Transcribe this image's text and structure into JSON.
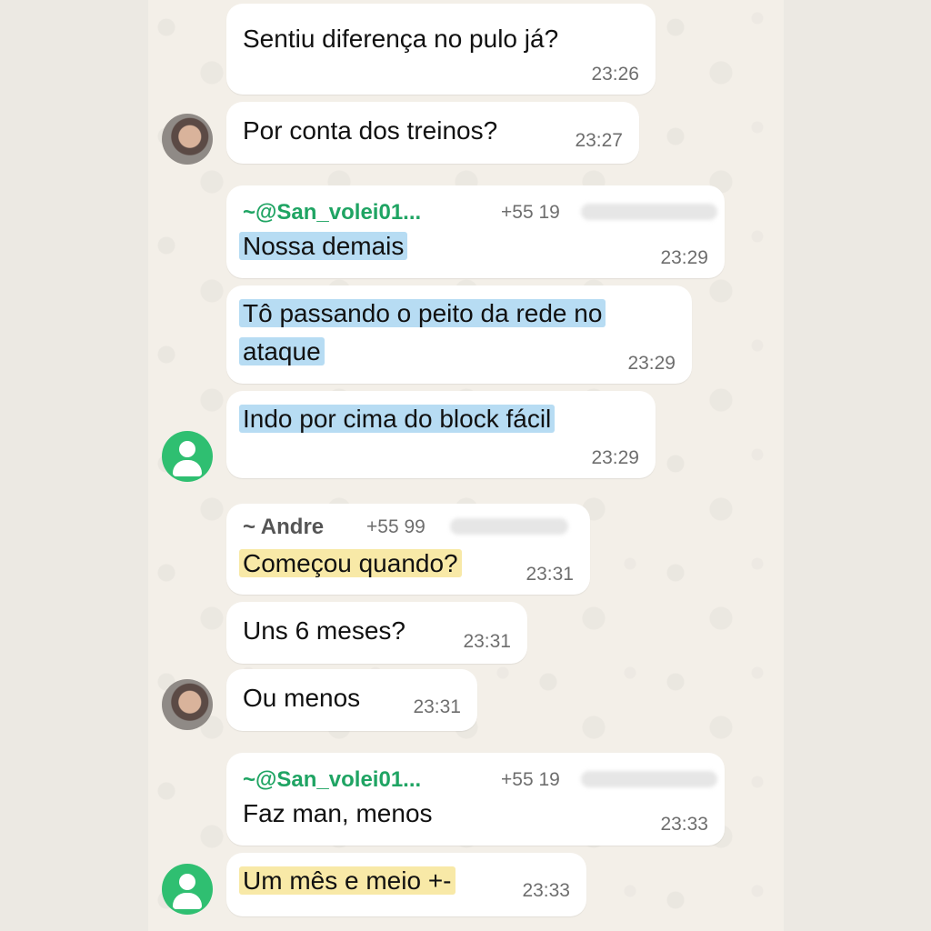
{
  "messages": [
    {
      "text": "Sentiu diferença no pulo já?",
      "time": "23:26"
    },
    {
      "text": "Por conta dos treinos?",
      "time": "23:27"
    },
    {
      "sender": "~@San_volei01...",
      "phone": "+55 19",
      "text": "Nossa demais",
      "time": "23:29"
    },
    {
      "line1": "Tô passando o peito da rede no",
      "line2": "ataque",
      "time": "23:29"
    },
    {
      "text": "Indo por cima do block fácil",
      "time": "23:29"
    },
    {
      "sender": "~ Andre",
      "phone": "+55 99",
      "text": "Começou quando?",
      "time": "23:31"
    },
    {
      "text": "Uns 6 meses?",
      "time": "23:31"
    },
    {
      "text": "Ou menos",
      "time": "23:31"
    },
    {
      "sender": "~@San_volei01...",
      "phone": "+55 19",
      "text": "Faz man, menos",
      "time": "23:33"
    },
    {
      "text": "Um mês e meio +-",
      "time": "23:33"
    }
  ],
  "colors": {
    "sender_green": "#1fa463",
    "highlight_blue": "#b7dcf3",
    "highlight_yellow": "#f8e9a7",
    "avatar_green": "#2fbf71"
  },
  "icons": {
    "default_avatar": "person-silhouette-icon"
  }
}
